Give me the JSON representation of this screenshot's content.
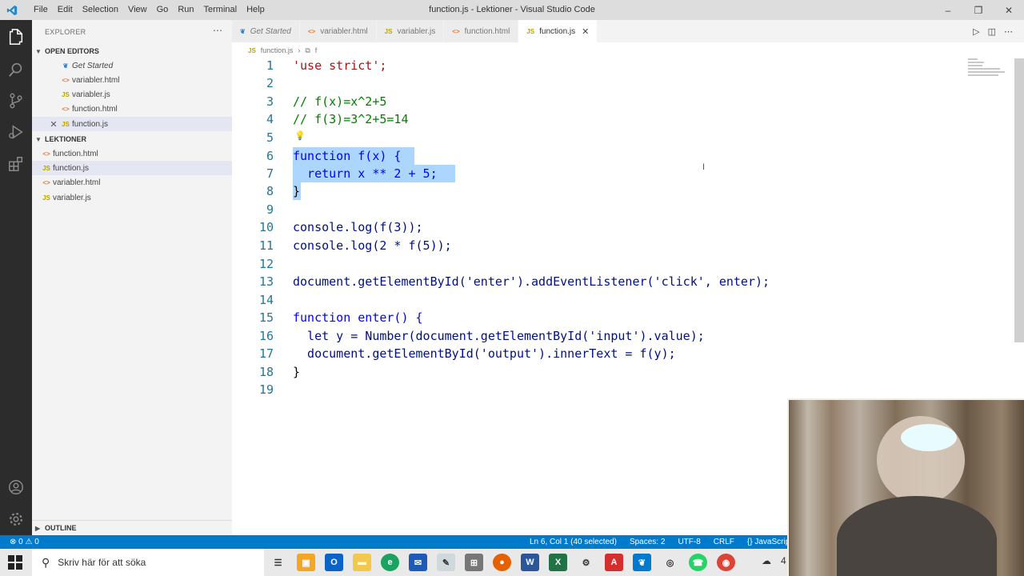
{
  "window": {
    "title": "function.js - Lektioner - Visual Studio Code",
    "menu": [
      "File",
      "Edit",
      "Selection",
      "View",
      "Go",
      "Run",
      "Terminal",
      "Help"
    ]
  },
  "sidebar": {
    "title": "EXPLORER",
    "open_editors_title": "OPEN EDITORS",
    "open_editors": [
      {
        "label": "Get Started",
        "icon": "vscode-icon"
      },
      {
        "label": "variabler.html",
        "icon": "html-icon"
      },
      {
        "label": "variabler.js",
        "icon": "js-icon"
      },
      {
        "label": "function.html",
        "icon": "html-icon"
      },
      {
        "label": "function.js",
        "icon": "js-icon"
      }
    ],
    "folder_title": "LEKTIONER",
    "folder_files": [
      {
        "label": "function.html",
        "icon": "html-icon"
      },
      {
        "label": "function.js",
        "icon": "js-icon"
      },
      {
        "label": "variabler.html",
        "icon": "html-icon"
      },
      {
        "label": "variabler.js",
        "icon": "js-icon"
      }
    ],
    "outline_title": "OUTLINE"
  },
  "tabs": [
    {
      "label": "Get Started",
      "icon": "vscode-icon"
    },
    {
      "label": "variabler.html",
      "icon": "html-icon"
    },
    {
      "label": "variabler.js",
      "icon": "js-icon"
    },
    {
      "label": "function.html",
      "icon": "html-icon"
    },
    {
      "label": "function.js",
      "icon": "js-icon",
      "active": true
    }
  ],
  "breadcrumb": {
    "file": "function.js",
    "symbol": "f"
  },
  "code_lines": [
    "'use strict';",
    "",
    "// f(x)=x^2+5",
    "// f(3)=3^2+5=14",
    "",
    "function f(x) {",
    "  return x ** 2 + 5;",
    "}",
    "",
    "console.log(f(3));",
    "console.log(2 * f(5));",
    "",
    "document.getElementById('enter').addEventListener('click', enter);",
    "",
    "function enter() {",
    "  let y = Number(document.getElementById('input').value);",
    "  document.getElementById('output').innerText = f(y);",
    "}",
    ""
  ],
  "statusbar": {
    "problems": "⊗ 0 ⚠ 0",
    "position": "Ln 6, Col 1 (40 selected)",
    "spaces": "Spaces: 2",
    "encoding": "UTF-8",
    "eol": "CRLF",
    "language": "{} JavaScript"
  },
  "taskbar": {
    "search_placeholder": "Skriv här för att söka",
    "tray_text": "4"
  },
  "colors": {
    "statusbar": "#007acc",
    "selection": "#add6ff",
    "activitybar": "#2c2c2c"
  }
}
